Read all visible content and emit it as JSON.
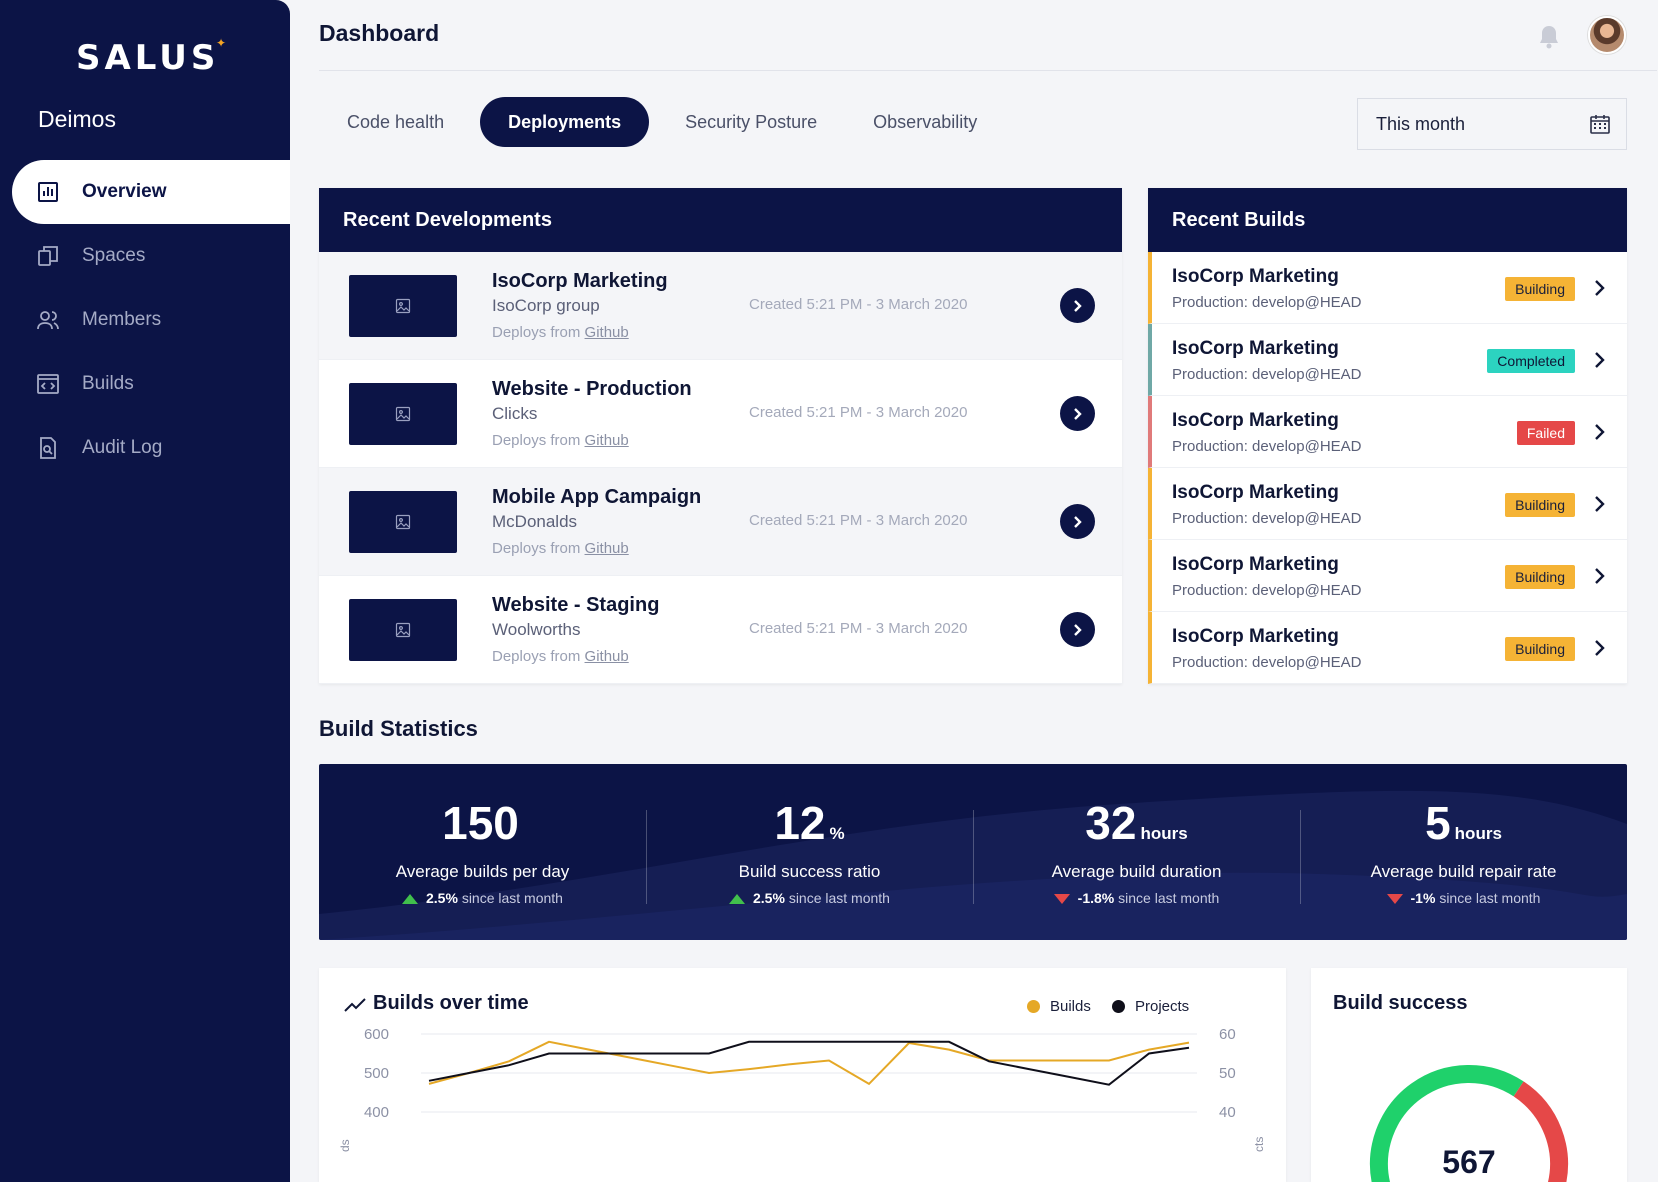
{
  "app": {
    "logo": "SALUS",
    "workspace": "Deimos"
  },
  "sidebar": {
    "items": [
      {
        "label": "Overview",
        "icon": "bar-chart-icon",
        "active": true
      },
      {
        "label": "Spaces",
        "icon": "spaces-icon"
      },
      {
        "label": "Members",
        "icon": "members-icon"
      },
      {
        "label": "Builds",
        "icon": "code-window-icon"
      },
      {
        "label": "Audit Log",
        "icon": "search-document-icon"
      }
    ]
  },
  "header": {
    "title": "Dashboard"
  },
  "tabs": [
    {
      "label": "Code health"
    },
    {
      "label": "Deployments",
      "active": true
    },
    {
      "label": "Security Posture"
    },
    {
      "label": "Observability"
    }
  ],
  "date_filter": {
    "value": "This month"
  },
  "recent_developments": {
    "title": "Recent Developments",
    "rows": [
      {
        "title": "IsoCorp Marketing",
        "group": "IsoCorp group",
        "deploys_prefix": "Deploys from",
        "deploys_source": "Github",
        "created": "Created 5:21 PM - 3 March 2020"
      },
      {
        "title": "Website - Production",
        "group": "Clicks",
        "deploys_prefix": "Deploys from",
        "deploys_source": "Github",
        "created": "Created 5:21 PM - 3 March 2020"
      },
      {
        "title": "Mobile App Campaign",
        "group": "McDonalds",
        "deploys_prefix": "Deploys from",
        "deploys_source": "Github",
        "created": "Created 5:21 PM - 3 March 2020"
      },
      {
        "title": "Website - Staging",
        "group": "Woolworths",
        "deploys_prefix": "Deploys from",
        "deploys_source": "Github",
        "created": "Created 5:21 PM - 3 March 2020"
      }
    ]
  },
  "recent_builds": {
    "title": "Recent Builds",
    "rows": [
      {
        "title": "IsoCorp Marketing",
        "branch": "Production: develop@HEAD",
        "status": "Building"
      },
      {
        "title": "IsoCorp Marketing",
        "branch": "Production: develop@HEAD",
        "status": "Completed"
      },
      {
        "title": "IsoCorp Marketing",
        "branch": "Production: develop@HEAD",
        "status": "Failed"
      },
      {
        "title": "IsoCorp Marketing",
        "branch": "Production: develop@HEAD",
        "status": "Building"
      },
      {
        "title": "IsoCorp Marketing",
        "branch": "Production: develop@HEAD",
        "status": "Building"
      },
      {
        "title": "IsoCorp Marketing",
        "branch": "Production: develop@HEAD",
        "status": "Building"
      }
    ],
    "status_colors": {
      "Building": {
        "bg": "#f5b335",
        "fg": "#1a1f3a",
        "accent": "#f5b335"
      },
      "Completed": {
        "bg": "#2cd3c0",
        "fg": "#0f1635",
        "accent": "#6fa8a6"
      },
      "Failed": {
        "bg": "#e54848",
        "fg": "#ffffff",
        "accent": "#e07a7a"
      }
    }
  },
  "build_statistics": {
    "title": "Build Statistics",
    "stats": [
      {
        "value": "150",
        "unit": "",
        "label": "Average builds per day",
        "delta": "2.5%",
        "delta_suffix": "since last month",
        "direction": "up"
      },
      {
        "value": "12",
        "unit": "%",
        "label": "Build success ratio",
        "delta": "2.5%",
        "delta_suffix": "since last month",
        "direction": "up"
      },
      {
        "value": "32",
        "unit": "hours",
        "label": "Average build duration",
        "delta": "-1.8%",
        "delta_suffix": "since last month",
        "direction": "down"
      },
      {
        "value": "5",
        "unit": "hours",
        "label": "Average build repair rate",
        "delta": "-1%",
        "delta_suffix": "since last month",
        "direction": "down"
      }
    ]
  },
  "chart_data": {
    "type": "line",
    "title": "Builds over time",
    "legend_placement": "top-right",
    "grid": true,
    "y_left": {
      "ticks": [
        "600",
        "500",
        "400"
      ],
      "range": [
        400,
        600
      ],
      "label_fragment": "ds"
    },
    "y_right": {
      "ticks": [
        "60",
        "50",
        "40"
      ],
      "range": [
        40,
        60
      ],
      "label_fragment": "cts"
    },
    "x": [
      0,
      1,
      2,
      3,
      4,
      5,
      6,
      7,
      8,
      9,
      10,
      11,
      12,
      13,
      14,
      15,
      16,
      17,
      18,
      19
    ],
    "series": [
      {
        "name": "Builds",
        "axis": "left",
        "color": "#e5a826",
        "values": [
          472,
          500,
          530,
          580,
          560,
          540,
          520,
          500,
          510,
          522,
          532,
          472,
          577,
          560,
          532,
          532,
          532,
          532,
          560,
          578
        ]
      },
      {
        "name": "Projects",
        "axis": "right",
        "color": "#0f0f1a",
        "values": [
          48,
          50,
          52,
          55,
          55,
          55,
          55,
          55,
          58,
          58,
          58,
          58,
          58,
          58,
          53,
          51,
          49,
          47,
          55,
          56.5
        ]
      }
    ]
  },
  "build_success": {
    "title": "Build success",
    "value": "567",
    "fraction": 0.88,
    "colors": {
      "good": "#1fd16b",
      "bad": "#e54848"
    }
  }
}
